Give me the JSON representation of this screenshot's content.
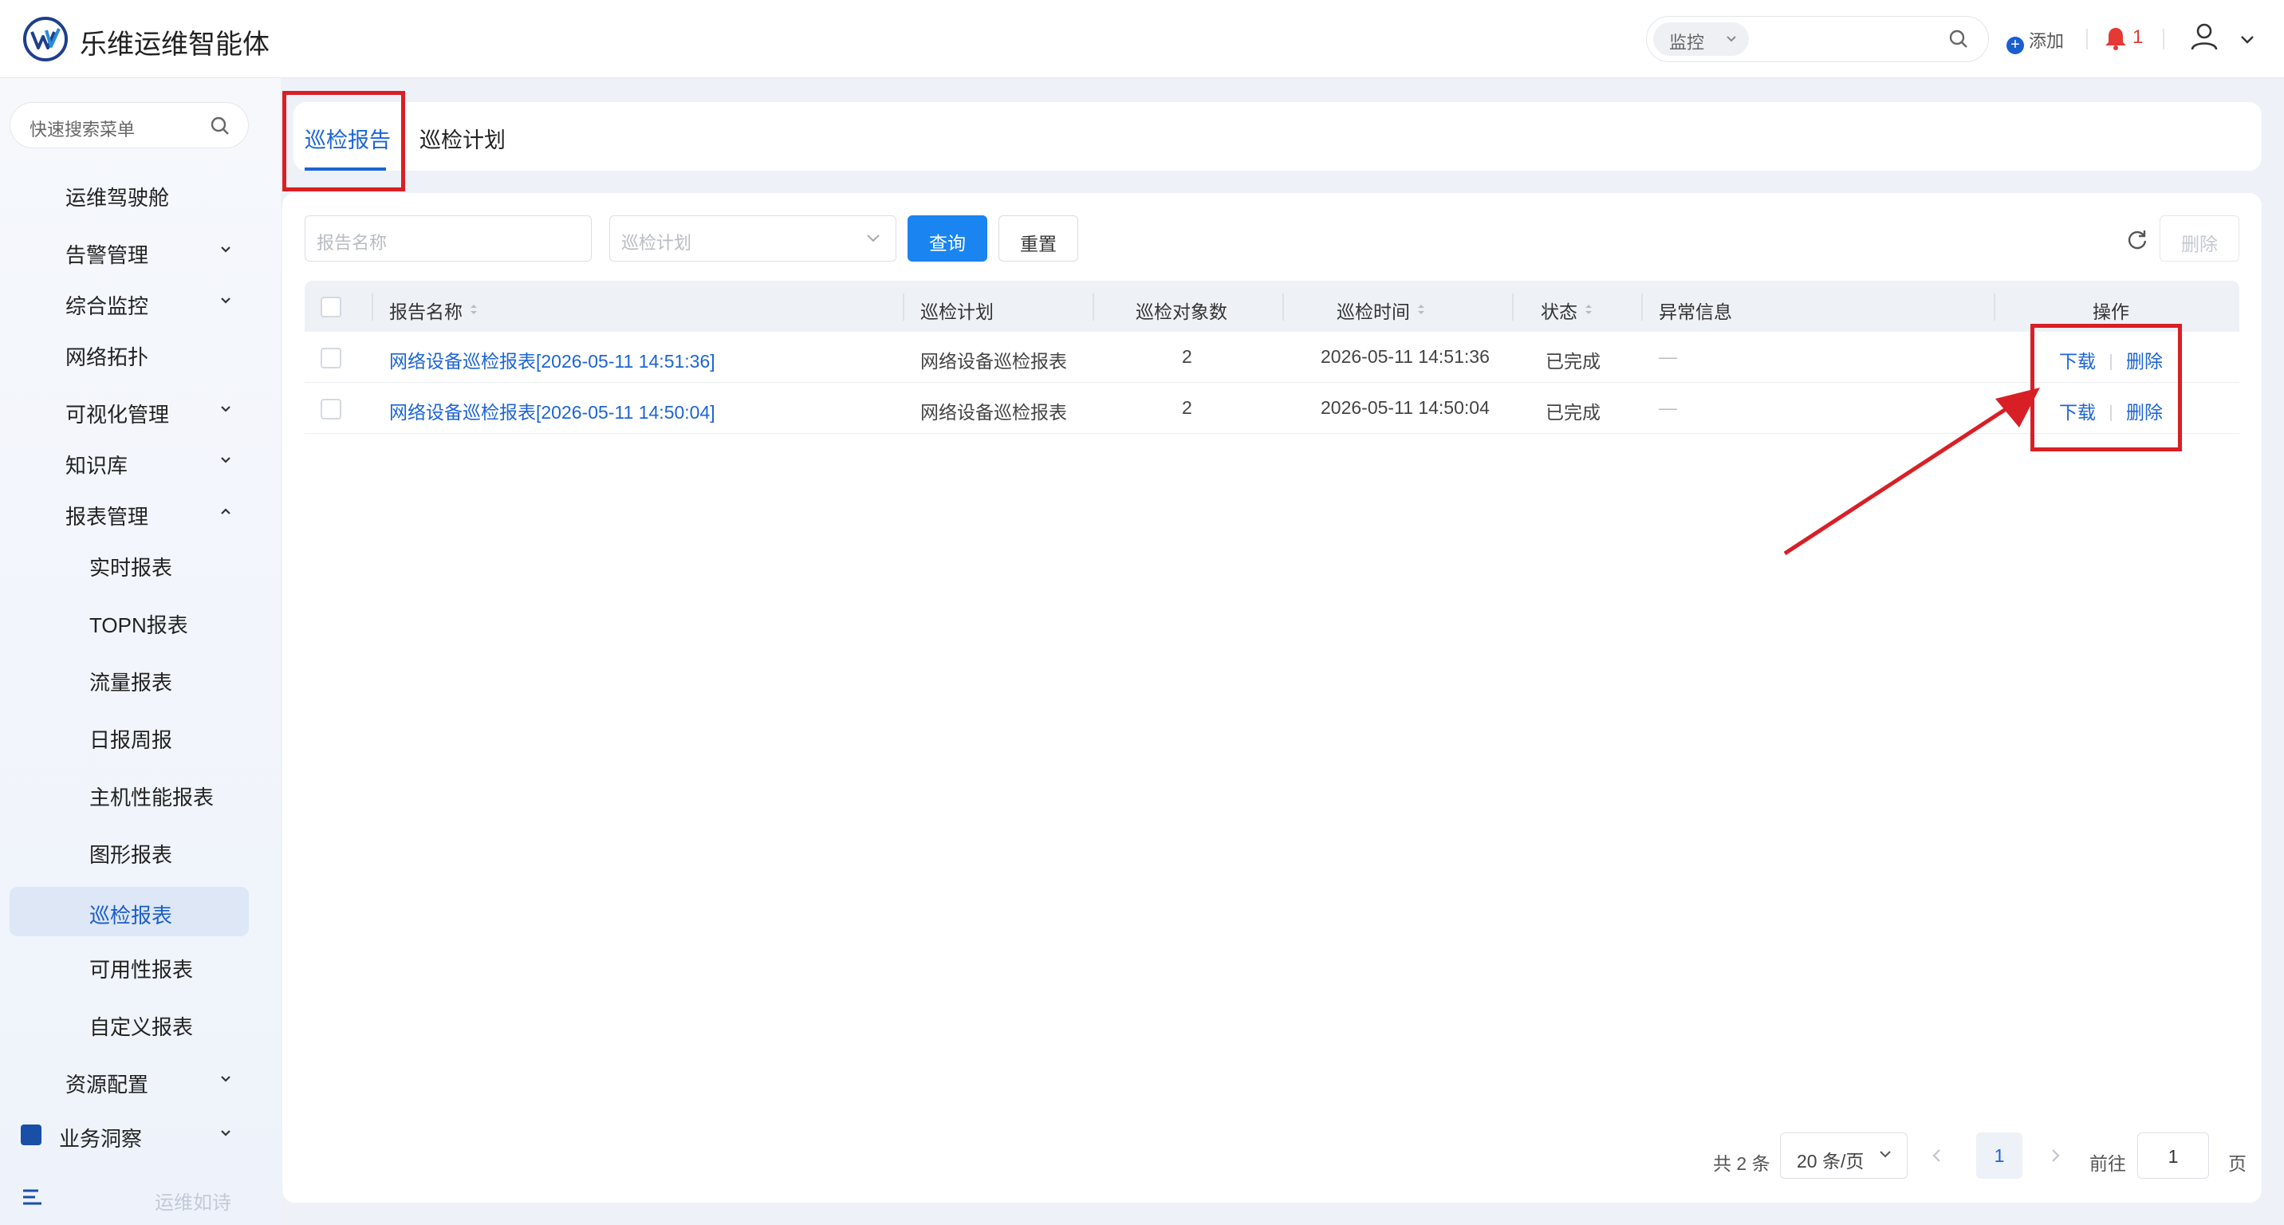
{
  "header": {
    "title": "乐维运维智能体",
    "monitor_select": "监控",
    "add_label": "添加",
    "alert_count": "1"
  },
  "sidebar": {
    "search_placeholder": "快速搜索菜单",
    "items": [
      {
        "label": "运维驾驶舱"
      },
      {
        "label": "告警管理"
      },
      {
        "label": "综合监控"
      },
      {
        "label": "网络拓扑"
      },
      {
        "label": "可视化管理"
      },
      {
        "label": "知识库"
      },
      {
        "label": "报表管理"
      },
      {
        "label": "实时报表"
      },
      {
        "label": "TOPN报表"
      },
      {
        "label": "流量报表"
      },
      {
        "label": "日报周报"
      },
      {
        "label": "主机性能报表"
      },
      {
        "label": "图形报表"
      },
      {
        "label": "巡检报表"
      },
      {
        "label": "可用性报表"
      },
      {
        "label": "自定义报表"
      },
      {
        "label": "资源配置"
      },
      {
        "label": "业务洞察"
      }
    ],
    "bottom_label": "运维如诗"
  },
  "tabs": [
    {
      "label": "巡检报告"
    },
    {
      "label": "巡检计划"
    }
  ],
  "filters": {
    "report_name_placeholder": "报告名称",
    "plan_placeholder": "巡检计划",
    "query_label": "查询",
    "reset_label": "重置",
    "delete_label": "删除"
  },
  "table": {
    "columns": [
      "报告名称",
      "巡检计划",
      "巡检对象数",
      "巡检时间",
      "状态",
      "异常信息",
      "操作"
    ],
    "rows": [
      {
        "name": "网络设备巡检报表[2026-05-11 14:51:36]",
        "plan": "网络设备巡检报表",
        "count": "2",
        "time": "2026-05-11 14:51:36",
        "status": "已完成",
        "error": "—",
        "download": "下载",
        "delete": "删除"
      },
      {
        "name": "网络设备巡检报表[2026-05-11 14:50:04]",
        "plan": "网络设备巡检报表",
        "count": "2",
        "time": "2026-05-11 14:50:04",
        "status": "已完成",
        "error": "—",
        "download": "下载",
        "delete": "删除"
      }
    ]
  },
  "pagination": {
    "total": "共 2 条",
    "page_size": "20 条/页",
    "current_page": "1",
    "goto_label": "前往",
    "goto_value": "1",
    "page_suffix": "页"
  },
  "colors": {
    "accent": "#1c64d6",
    "primary_button": "#1a84f0",
    "highlight": "#d91f26",
    "alert": "#e53935"
  }
}
